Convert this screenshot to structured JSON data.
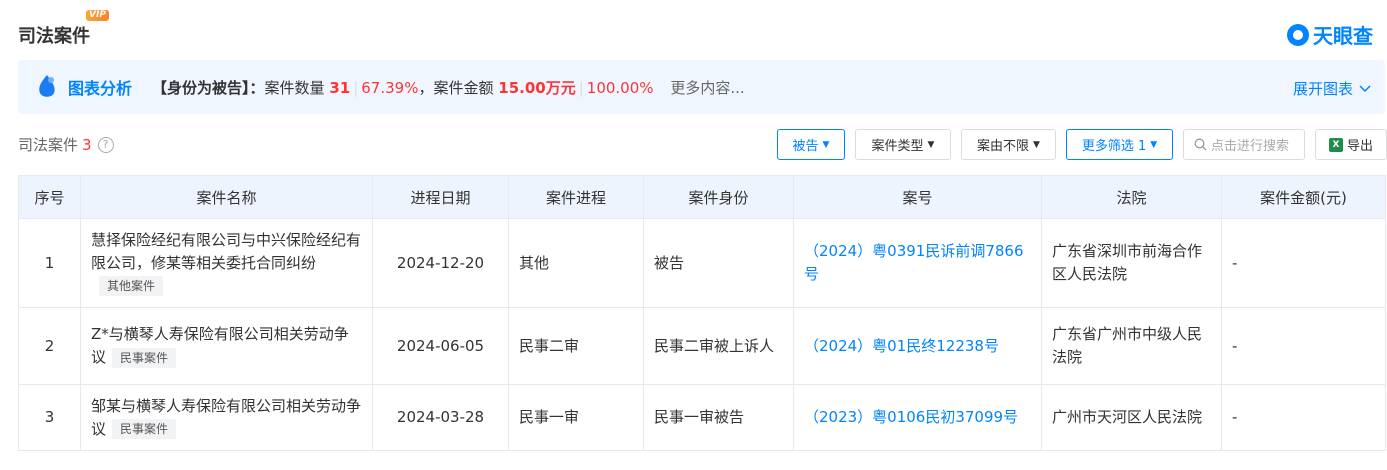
{
  "header": {
    "title": "司法案件",
    "vip_badge": "VIP",
    "brand": "天眼查"
  },
  "banner": {
    "title": "图表分析",
    "role": "【身份为被告】：",
    "count_label": "案件数量",
    "count_value": "31",
    "count_pct": "67.39%",
    "amount_label": "，案件金额",
    "amount_value": "15.00万元",
    "amount_pct": "100.00%",
    "more": "更多内容...",
    "expand": "展开图表"
  },
  "toolbar": {
    "count_label": "司法案件",
    "count_value": "3",
    "help": "?",
    "filters": {
      "role": "被告",
      "case_type": "案件类型",
      "cause": "案由不限",
      "more": "更多筛选 1"
    },
    "search_placeholder": "点击进行搜索",
    "export": "导出"
  },
  "table": {
    "headers": [
      "序号",
      "案件名称",
      "进程日期",
      "案件进程",
      "案件身份",
      "案号",
      "法院",
      "案件金额(元)"
    ],
    "rows": [
      {
        "no": "1",
        "name": "慧择保险经纪有限公司与中兴保险经纪有限公司，修某等相关委托合同纠纷",
        "tag": "其他案件",
        "date": "2024-12-20",
        "stage": "其他",
        "role": "被告",
        "case_no": "（2024）粤0391民诉前调7866号",
        "court": "广东省深圳市前海合作区人民法院",
        "amount": "-"
      },
      {
        "no": "2",
        "name": "Z*与横琴人寿保险有限公司相关劳动争议",
        "tag": "民事案件",
        "date": "2024-06-05",
        "stage": "民事二审",
        "role": "民事二审被上诉人",
        "case_no": "（2024）粤01民终12238号",
        "court": "广东省广州市中级人民法院",
        "amount": "-"
      },
      {
        "no": "3",
        "name": "邹某与横琴人寿保险有限公司相关劳动争议",
        "tag": "民事案件",
        "date": "2024-03-28",
        "stage": "民事一审",
        "role": "民事一审被告",
        "case_no": "（2023）粤0106民初37099号",
        "court": "广州市天河区人民法院",
        "amount": "-"
      }
    ]
  },
  "colors": {
    "accent": "#0084ff",
    "highlight": "#ff3333",
    "header_bg": "#eef4fd",
    "banner_bg": "#f0f6ff"
  }
}
